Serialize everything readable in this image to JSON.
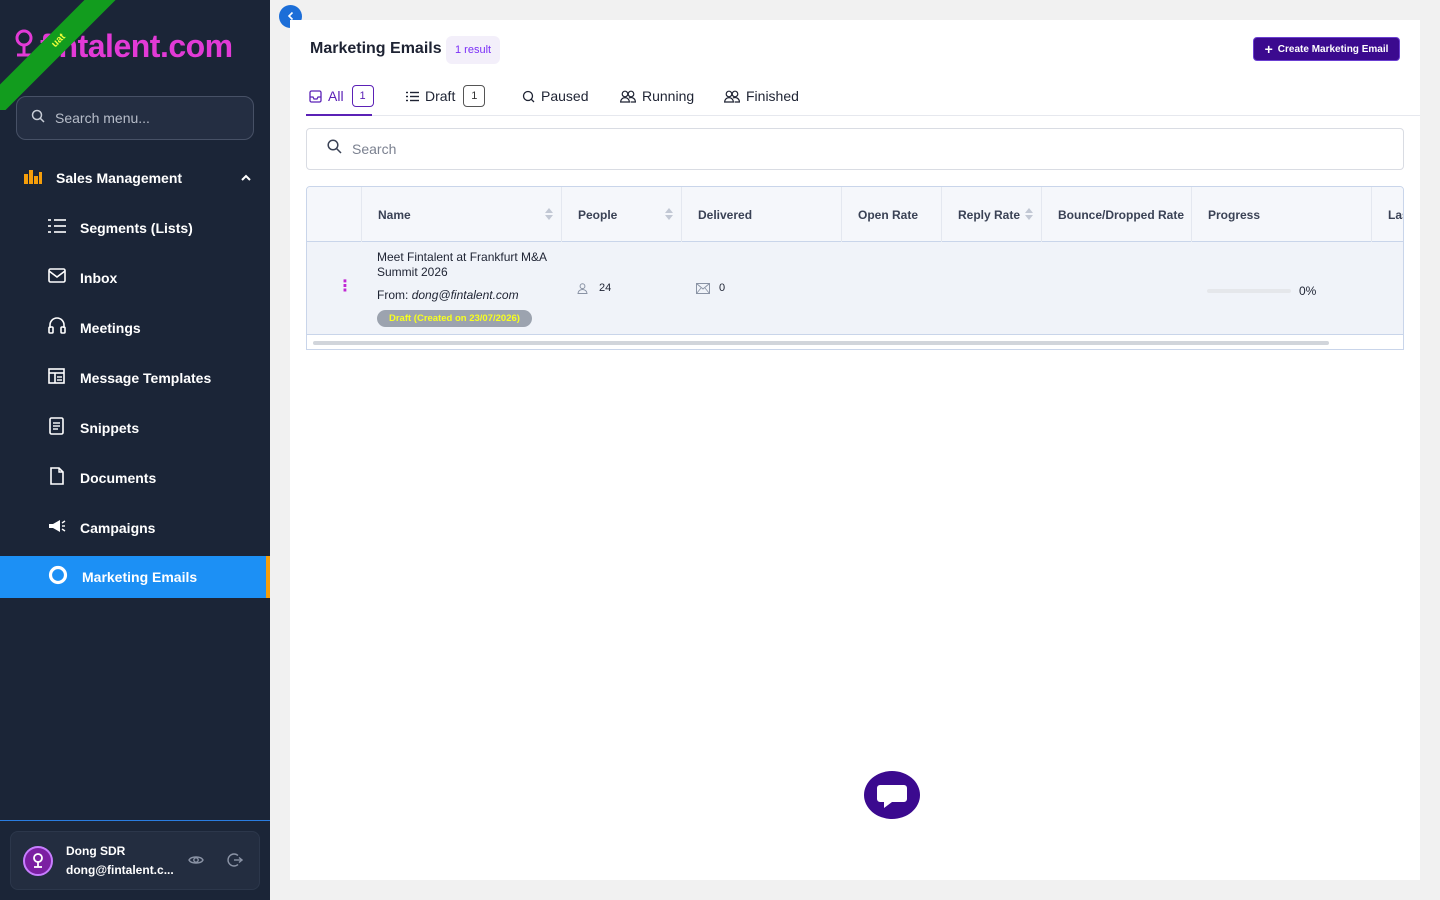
{
  "brand": {
    "logo_text": "fintalent.com",
    "ribbon": "uat"
  },
  "sidebar": {
    "search_placeholder": "Search menu...",
    "section": {
      "label": "Sales Management",
      "expanded": true
    },
    "items": [
      {
        "label": "Segments (Lists)",
        "icon": "list-icon"
      },
      {
        "label": "Inbox",
        "icon": "inbox-icon"
      },
      {
        "label": "Meetings",
        "icon": "headset-icon"
      },
      {
        "label": "Message Templates",
        "icon": "template-icon"
      },
      {
        "label": "Snippets",
        "icon": "snippet-icon"
      },
      {
        "label": "Documents",
        "icon": "document-icon"
      },
      {
        "label": "Campaigns",
        "icon": "megaphone-icon"
      },
      {
        "label": "Marketing Emails",
        "icon": "circle-icon",
        "active": true
      }
    ],
    "user": {
      "name": "Dong SDR",
      "email": "dong@fintalent.c..."
    }
  },
  "header": {
    "title": "Marketing Emails",
    "result_count": "1 result",
    "create_button": "Create Marketing Email"
  },
  "tabs": [
    {
      "label": "All",
      "count": "1",
      "active": true
    },
    {
      "label": "Draft",
      "count": "1"
    },
    {
      "label": "Paused"
    },
    {
      "label": "Running"
    },
    {
      "label": "Finished"
    }
  ],
  "search": {
    "placeholder": "Search"
  },
  "table": {
    "columns": [
      "Name",
      "People",
      "Delivered",
      "Open Rate",
      "Reply Rate",
      "Bounce/Dropped Rate",
      "Progress",
      "Las"
    ],
    "rows": [
      {
        "name": "Meet Fintalent at Frankfurt M&A Summit 2026",
        "from_label": "From:",
        "from_email": "dong@fintalent.com",
        "status": "Draft (Created on 23/07/2026)",
        "people": "24",
        "delivered": "0",
        "open_rate": "",
        "reply_rate": "",
        "bounce_rate": "",
        "progress": 0,
        "progress_label": "0%"
      }
    ]
  },
  "colors": {
    "sidebar_bg": "#1b2537",
    "active_item": "#1c90f5",
    "brand_pink": "#e23ad6",
    "primary_purple": "#3b0a8f"
  }
}
